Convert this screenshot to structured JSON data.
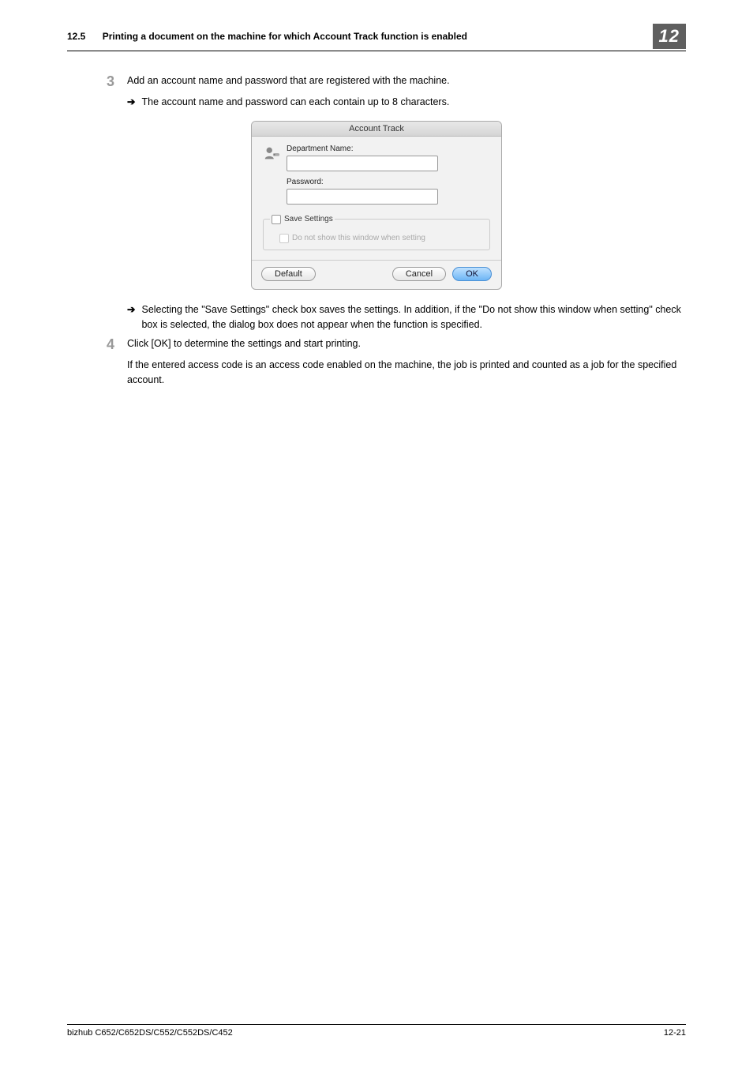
{
  "header": {
    "section_number": "12.5",
    "section_title": "Printing a document on the machine for which Account Track function is enabled",
    "chapter_badge": "12"
  },
  "steps": {
    "s3": {
      "num": "3",
      "text": "Add an account name and password that are registered with the machine.",
      "sub_a": "The account name and password can each contain up to 8 characters.",
      "sub_b": "Selecting the \"Save Settings\" check box saves the settings. In addition, if the \"Do not show this window when setting\" check box is selected, the dialog box does not appear when the function is specified."
    },
    "s4": {
      "num": "4",
      "text_a": "Click [OK] to determine the settings and start printing.",
      "text_b": "If the entered access code is an access code enabled on the machine, the job is printed and counted as a job for the specified account."
    }
  },
  "dialog": {
    "title": "Account Track",
    "dept_label": "Department Name:",
    "password_label": "Password:",
    "save_settings": "Save Settings",
    "do_not_show": "Do not show this window when setting",
    "default_btn": "Default",
    "cancel_btn": "Cancel",
    "ok_btn": "OK"
  },
  "footer": {
    "model": "bizhub C652/C652DS/C552/C552DS/C452",
    "page": "12-21"
  }
}
